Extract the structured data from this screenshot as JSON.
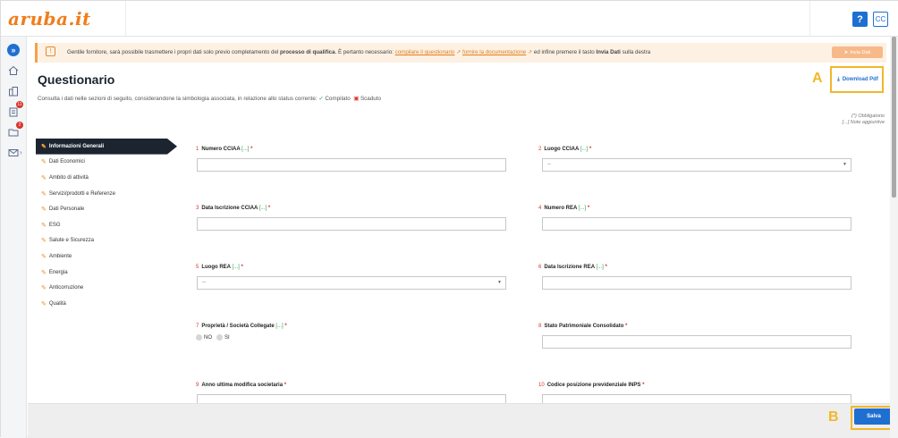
{
  "header": {
    "logo": "aruba.it",
    "help_label": "?",
    "avatar_initials": "CC"
  },
  "sidebar": {
    "items": [
      {
        "icon": "chevron-right-circle-icon"
      },
      {
        "icon": "home-icon"
      },
      {
        "icon": "building-icon"
      },
      {
        "icon": "clipboard-icon",
        "badge": "11"
      },
      {
        "icon": "folder-icon",
        "badge": "2"
      },
      {
        "icon": "mail-icon"
      }
    ]
  },
  "banner": {
    "text_before": "Gentile fornitore, sarà possibile trasmettere i propri dati solo previo completamento del ",
    "bold_text": "processo di qualifica",
    "text_mid": ". È pertanto necessario: ",
    "link1": "compilare il questionario",
    "link2": "fornire la documentazione",
    "text_after": " ed infine premere il tasto ",
    "bold_send": "Invia Dati",
    "text_end": " sulla destra",
    "send_button": "Invia Dati"
  },
  "page": {
    "title": "Questionario",
    "subtitle": "Consulta i dati nelle sezioni di seguito, considerandone la simbologia associata, in relazione allo status corrente:",
    "status_done": "Compilato",
    "status_expired": "Scaduto",
    "download_label": "Download Pdf",
    "legend_required": "(*) Obbligatorio",
    "legend_notes": "[...] Note aggiuntive"
  },
  "nav": {
    "items": [
      {
        "label": "Informazioni Generali"
      },
      {
        "label": "Dati Economici"
      },
      {
        "label": "Ambito di attività"
      },
      {
        "label": "Servizi/prodotti e Referenze"
      },
      {
        "label": "Dati Personale"
      },
      {
        "label": "ESG"
      },
      {
        "label": "Salute e Sicurezza"
      },
      {
        "label": "Ambiente"
      },
      {
        "label": "Energia"
      },
      {
        "label": "Anticorruzione"
      },
      {
        "label": "Qualità"
      }
    ]
  },
  "fields": [
    {
      "num": "1",
      "label": "Numero CCIAA",
      "dots": "[...]",
      "req": "*",
      "value": ""
    },
    {
      "num": "2",
      "label": "Luogo CCIAA",
      "dots": "[...]",
      "req": "*",
      "value": "--"
    },
    {
      "num": "3",
      "label": "Data Iscrizione CCIAA",
      "dots": "[...]",
      "req": "*",
      "value": ""
    },
    {
      "num": "4",
      "label": "Numero REA",
      "dots": "[...]",
      "req": "*",
      "value": ""
    },
    {
      "num": "5",
      "label": "Luogo REA",
      "dots": "[...]",
      "req": "*",
      "value": "--"
    },
    {
      "num": "6",
      "label": "Data Iscrizione REA",
      "dots": "[...]",
      "req": "*",
      "value": ""
    },
    {
      "num": "7",
      "label": "Proprietà / Società Collegate",
      "dots": "[...]",
      "req": "*",
      "opt_no": "NO",
      "opt_si": "SI"
    },
    {
      "num": "8",
      "label": "Stato Patrimoniale Consolidato",
      "dots": "",
      "req": "*",
      "value": ""
    },
    {
      "num": "9",
      "label": "Anno ultima modifica societaria",
      "dots": "",
      "req": "*",
      "value": ""
    },
    {
      "num": "10",
      "label": "Codice posizione previdenziale INPS",
      "dots": "",
      "req": "*",
      "value": ""
    }
  ],
  "annotations": {
    "a": "A",
    "b": "B"
  },
  "footer": {
    "save_label": "Salva"
  },
  "colors": {
    "accent": "#1f6fd1",
    "brand": "#f07d1a",
    "highlight": "#f2b72a",
    "nav_active": "#1c2430"
  }
}
